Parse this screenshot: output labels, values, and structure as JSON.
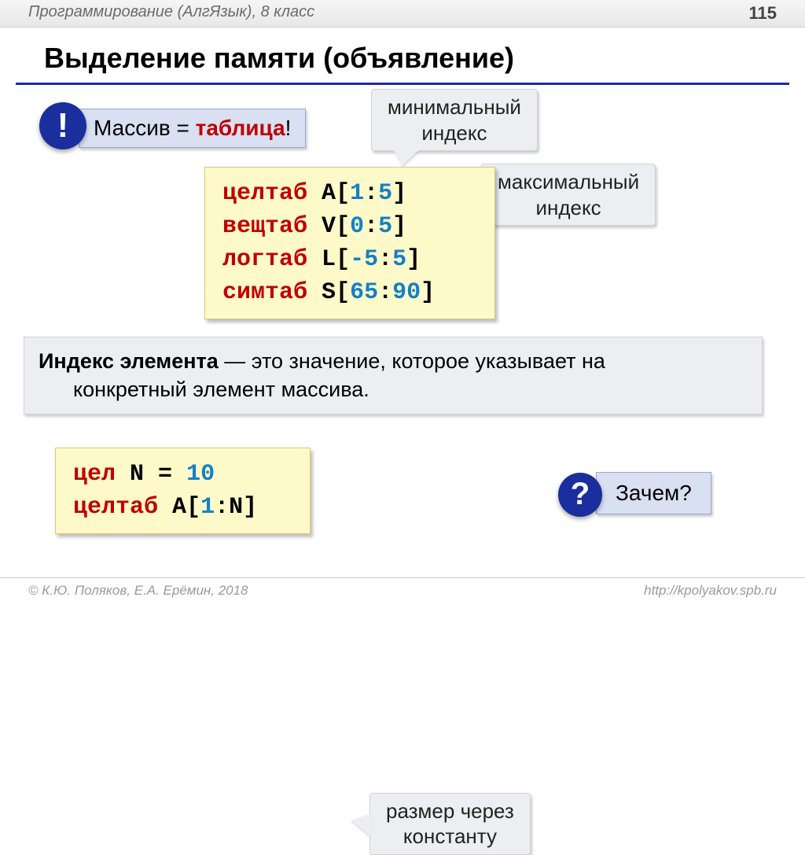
{
  "header": {
    "subject": "Программирование (АлгЯзык), 8 класс",
    "page_number": "115"
  },
  "title": "Выделение памяти (объявление)",
  "exclaim": {
    "symbol": "!",
    "text_prefix": "Массив = ",
    "text_bold": "таблица",
    "text_suffix": "!"
  },
  "callouts": {
    "min_l1": "минимальный",
    "min_l2": "индекс",
    "max_l1": "максимальный",
    "max_l2": "индекс",
    "const_l1": "размер через",
    "const_l2": "константу"
  },
  "code1": {
    "lines": [
      {
        "kw": "целтаб",
        "name": "A",
        "lo": "1",
        "hi": "5"
      },
      {
        "kw": "вещтаб",
        "name": "V",
        "lo": "0",
        "hi": "5"
      },
      {
        "kw": "логтаб",
        "name": "L",
        "lo": "-5",
        "hi": "5"
      },
      {
        "kw": "симтаб",
        "name": "S",
        "lo": "65",
        "hi": "90"
      }
    ]
  },
  "definition": {
    "bold": "Индекс элемента",
    "line1_rest": " — это значение, которое указывает на",
    "line2": "конкретный элемент массива."
  },
  "code2": {
    "line1": {
      "kw": "цел",
      "name": "N",
      "eq": " = ",
      "val": "10"
    },
    "line2": {
      "kw": "целтаб",
      "name": "A",
      "lo": "1",
      "hi": "N"
    }
  },
  "question": {
    "symbol": "?",
    "text": "Зачем?"
  },
  "footer": {
    "left": "© К.Ю. Поляков, Е.А. Ерёмин, 2018",
    "right": "http://kpolyakov.spb.ru"
  }
}
